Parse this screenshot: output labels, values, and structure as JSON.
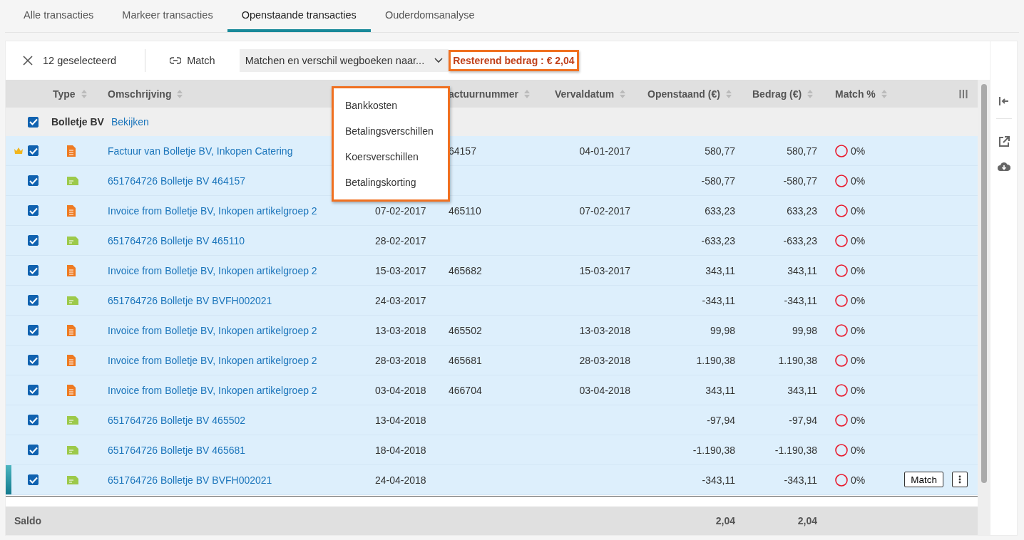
{
  "tabs": [
    {
      "label": "Alle transacties",
      "selected": false
    },
    {
      "label": "Markeer transacties",
      "selected": false
    },
    {
      "label": "Openstaande transacties",
      "selected": true
    },
    {
      "label": "Ouderdomsanalyse",
      "selected": false
    }
  ],
  "toolbar": {
    "selection": "12 geselecteerd",
    "match": "Match",
    "dropdown": "Matchen en verschil wegboeken naar...",
    "remaining": "Resterend bedrag : € 2,04"
  },
  "dropdown_menu": [
    "Bankkosten",
    "Betalingsverschillen",
    "Koersverschillen",
    "Betalingskorting"
  ],
  "table": {
    "columns": [
      "Type",
      "Omschrijving",
      "actuurnummer",
      "Vervaldatum",
      "Openstaand (€)",
      "Bedrag (€)",
      "Match %"
    ],
    "group": {
      "name": "Bolletje BV",
      "link": "Bekijken",
      "checked": true
    },
    "rows": [
      {
        "kind": "invoice",
        "checked": true,
        "crown": true,
        "active": false,
        "description": "Factuur van Bolletje BV, Inkopen Catering",
        "date": "",
        "invoice_no": "64157",
        "due_date": "04-01-2017",
        "open": "580,77",
        "amount": "580,77",
        "match": "0%"
      },
      {
        "kind": "bank",
        "checked": true,
        "crown": false,
        "active": false,
        "description": "651764726 Bolletje BV 464157",
        "date": "",
        "invoice_no": "",
        "due_date": "",
        "open": "-580,77",
        "amount": "-580,77",
        "match": "0%"
      },
      {
        "kind": "invoice",
        "checked": true,
        "crown": false,
        "active": false,
        "description": "Invoice from Bolletje BV, Inkopen artikelgroep 2",
        "date": "07-02-2017",
        "invoice_no": "465110",
        "due_date": "07-02-2017",
        "open": "633,23",
        "amount": "633,23",
        "match": "0%"
      },
      {
        "kind": "bank",
        "checked": true,
        "crown": false,
        "active": false,
        "description": "651764726 Bolletje BV 465110",
        "date": "28-02-2017",
        "invoice_no": "",
        "due_date": "",
        "open": "-633,23",
        "amount": "-633,23",
        "match": "0%"
      },
      {
        "kind": "invoice",
        "checked": true,
        "crown": false,
        "active": false,
        "description": "Invoice from Bolletje BV, Inkopen artikelgroep 2",
        "date": "15-03-2017",
        "invoice_no": "465682",
        "due_date": "15-03-2017",
        "open": "343,11",
        "amount": "343,11",
        "match": "0%"
      },
      {
        "kind": "bank",
        "checked": true,
        "crown": false,
        "active": false,
        "description": "651764726 Bolletje BV BVFH002021",
        "date": "24-03-2017",
        "invoice_no": "",
        "due_date": "",
        "open": "-343,11",
        "amount": "-343,11",
        "match": "0%"
      },
      {
        "kind": "invoice",
        "checked": true,
        "crown": false,
        "active": false,
        "description": "Invoice from Bolletje BV, Inkopen artikelgroep 2",
        "date": "13-03-2018",
        "invoice_no": "465502",
        "due_date": "13-03-2018",
        "open": "99,98",
        "amount": "99,98",
        "match": "0%"
      },
      {
        "kind": "invoice",
        "checked": true,
        "crown": false,
        "active": false,
        "description": "Invoice from Bolletje BV, Inkopen artikelgroep 2",
        "date": "28-03-2018",
        "invoice_no": "465681",
        "due_date": "28-03-2018",
        "open": "1.190,38",
        "amount": "1.190,38",
        "match": "0%"
      },
      {
        "kind": "invoice",
        "checked": true,
        "crown": false,
        "active": false,
        "description": "Invoice from Bolletje BV, Inkopen artikelgroep 2",
        "date": "03-04-2018",
        "invoice_no": "466704",
        "due_date": "03-04-2018",
        "open": "343,11",
        "amount": "343,11",
        "match": "0%"
      },
      {
        "kind": "bank",
        "checked": true,
        "crown": false,
        "active": false,
        "description": "651764726 Bolletje BV 465502",
        "date": "13-04-2018",
        "invoice_no": "",
        "due_date": "",
        "open": "-97,94",
        "amount": "-97,94",
        "match": "0%"
      },
      {
        "kind": "bank",
        "checked": true,
        "crown": false,
        "active": false,
        "description": "651764726 Bolletje BV 465681",
        "date": "18-04-2018",
        "invoice_no": "",
        "due_date": "",
        "open": "-1.190,38",
        "amount": "-1.190,38",
        "match": "0%"
      },
      {
        "kind": "bank",
        "checked": true,
        "crown": false,
        "active": true,
        "description": "651764726 Bolletje BV BVFH002021",
        "date": "24-04-2018",
        "invoice_no": "",
        "due_date": "",
        "open": "-343,11",
        "amount": "-343,11",
        "match": "0%",
        "action": "Match"
      }
    ],
    "footer": {
      "label": "Saldo",
      "open": "2,04",
      "amount": "2,04"
    }
  }
}
